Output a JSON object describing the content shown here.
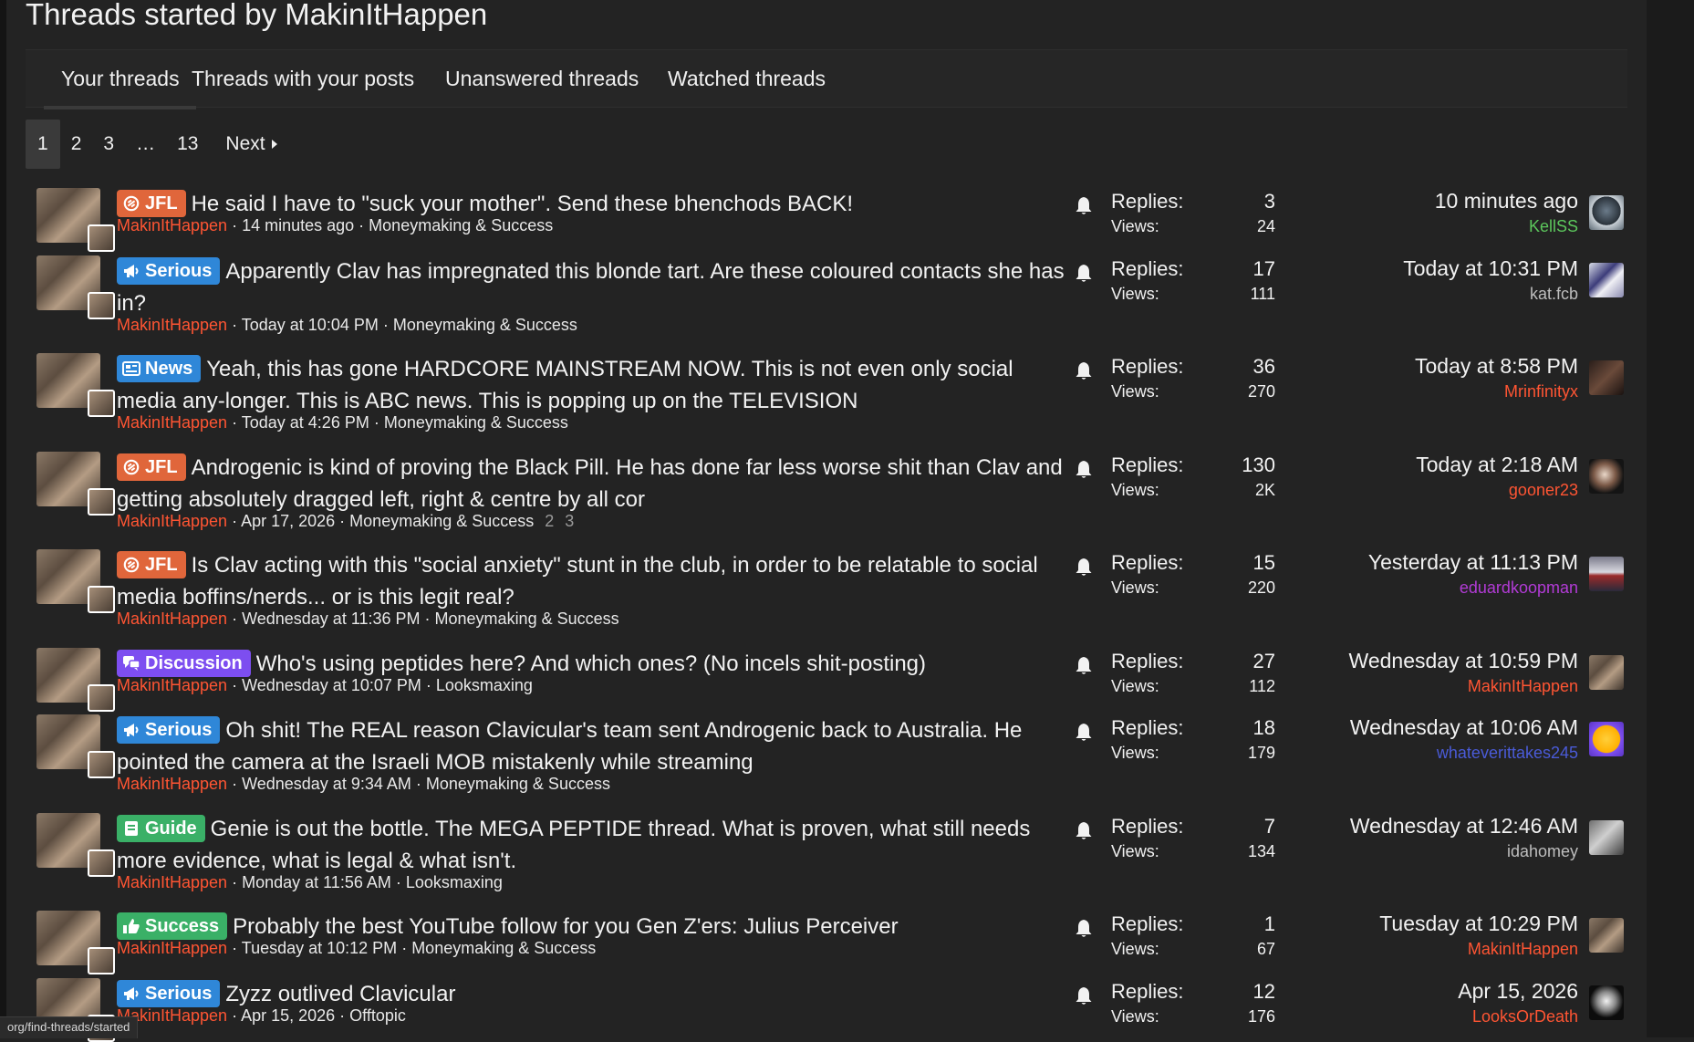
{
  "page": {
    "title": "Threads started by MakinItHappen"
  },
  "tabs": [
    {
      "label": "Your threads",
      "active": true
    },
    {
      "label": "Threads with your posts",
      "active": false
    },
    {
      "label": "Unanswered threads",
      "active": false
    },
    {
      "label": "Watched threads",
      "active": false
    }
  ],
  "pagination": {
    "pages": [
      "1",
      "2",
      "3"
    ],
    "ellipsis": "…",
    "last": "13",
    "next": "Next",
    "current": "1"
  },
  "stat_labels": {
    "replies": "Replies:",
    "views": "Views:"
  },
  "threads": [
    {
      "prefix": "JFL",
      "prefix_type": "jfl",
      "title": "He said I have to \"suck your mother\". Send these bhenchods BACK!",
      "author": "MakinItHappen",
      "when": "14 minutes ago",
      "forum": "Moneymaking & Success",
      "pages": [],
      "replies": "3",
      "views": "24",
      "last_time": "10 minutes ago",
      "last_user": "KellSS",
      "last_user_color": "#5cc75c",
      "last_avatar": "helmet"
    },
    {
      "prefix": "Serious",
      "prefix_type": "serious",
      "title": "Apparently Clav has impregnated this blonde tart. Are these coloured contacts she has in?",
      "author": "MakinItHappen",
      "when": "Today at 10:04 PM",
      "forum": "Moneymaking & Success",
      "pages": [],
      "replies": "17",
      "views": "111",
      "last_time": "Today at 10:31 PM",
      "last_user": "kat.fcb",
      "last_user_color": "#bdbdbd",
      "last_avatar": "anime"
    },
    {
      "prefix": "News",
      "prefix_type": "news",
      "title": "Yeah, this has gone HARDCORE MAINSTREAM NOW. This is not even only social media any-longer. This is ABC news. This is popping up on the TELEVISION",
      "author": "MakinItHappen",
      "when": "Today at 4:26 PM",
      "forum": "Moneymaking & Success",
      "pages": [],
      "replies": "36",
      "views": "270",
      "last_time": "Today at 8:58 PM",
      "last_user": "Mrinfinityx",
      "last_user_color": "#ff5533",
      "last_avatar": "dark"
    },
    {
      "prefix": "JFL",
      "prefix_type": "jfl",
      "title": "Androgenic is kind of proving the Black Pill. He has done far less worse shit than Clav and getting absolutely dragged left, right & centre by all cor",
      "author": "MakinItHappen",
      "when": "Apr 17, 2026",
      "forum": "Moneymaking & Success",
      "pages": [
        "2",
        "3"
      ],
      "replies": "130",
      "views": "2K",
      "last_time": "Today at 2:18 AM",
      "last_user": "gooner23",
      "last_user_color": "#ff5533",
      "last_avatar": "face"
    },
    {
      "prefix": "JFL",
      "prefix_type": "jfl",
      "title": "Is Clav acting with this \"social anxiety\" stunt in the club, in order to be relatable to social media boffins/nerds... or is this legit real?",
      "author": "MakinItHappen",
      "when": "Wednesday at 11:36 PM",
      "forum": "Moneymaking & Success",
      "pages": [],
      "replies": "15",
      "views": "220",
      "last_time": "Yesterday at 11:13 PM",
      "last_user": "eduardkoopman",
      "last_user_color": "#b23bd6",
      "last_avatar": "flag"
    },
    {
      "prefix": "Discussion",
      "prefix_type": "discussion",
      "title": "Who's using peptides here? And which ones? (No incels shit-posting)",
      "author": "MakinItHappen",
      "when": "Wednesday at 10:07 PM",
      "forum": "Looksmaxing",
      "pages": [],
      "replies": "27",
      "views": "112",
      "last_time": "Wednesday at 10:59 PM",
      "last_user": "MakinItHappen",
      "last_user_color": "#ff5533",
      "last_avatar": "self"
    },
    {
      "prefix": "Serious",
      "prefix_type": "serious",
      "title": "Oh shit! The REAL reason Clavicular's team sent Androgenic back to Australia. He pointed the camera at the Israeli MOB mistakenly while streaming",
      "author": "MakinItHappen",
      "when": "Wednesday at 9:34 AM",
      "forum": "Moneymaking & Success",
      "pages": [],
      "replies": "18",
      "views": "179",
      "last_time": "Wednesday at 10:06 AM",
      "last_user": "whateverittakes245",
      "last_user_color": "#4a5bd8",
      "last_avatar": "emoji"
    },
    {
      "prefix": "Guide",
      "prefix_type": "guide",
      "title": "Genie is out the bottle. The MEGA PEPTIDE thread. What is proven, what still needs more evidence, what is legal & what isn't.",
      "author": "MakinItHappen",
      "when": "Monday at 11:56 AM",
      "forum": "Looksmaxing",
      "pages": [],
      "replies": "7",
      "views": "134",
      "last_time": "Wednesday at 12:46 AM",
      "last_user": "idahomey",
      "last_user_color": "#bdbdbd",
      "last_avatar": "grey"
    },
    {
      "prefix": "Success",
      "prefix_type": "success",
      "title": "Probably the best YouTube follow for you Gen Z'ers: Julius Perceiver",
      "author": "MakinItHappen",
      "when": "Tuesday at 10:12 PM",
      "forum": "Moneymaking & Success",
      "pages": [],
      "replies": "1",
      "views": "67",
      "last_time": "Tuesday at 10:29 PM",
      "last_user": "MakinItHappen",
      "last_user_color": "#ff5533",
      "last_avatar": "self"
    },
    {
      "prefix": "Serious",
      "prefix_type": "serious",
      "title": "Zyzz outlived Clavicular",
      "author": "MakinItHappen",
      "when": "Apr 15, 2026",
      "forum": "Offtopic",
      "pages": [],
      "replies": "12",
      "views": "176",
      "last_time": "Apr 15, 2026",
      "last_user": "LooksOrDeath",
      "last_user_color": "#ff5533",
      "last_avatar": "bw"
    }
  ],
  "status_url": "org/find-threads/started",
  "colors": {
    "author": "#ff5533",
    "background": "#232323",
    "jfl": "#e0663b",
    "serious": "#2f87d8",
    "discussion": "#7d4ef0",
    "guide": "#3ab067"
  }
}
